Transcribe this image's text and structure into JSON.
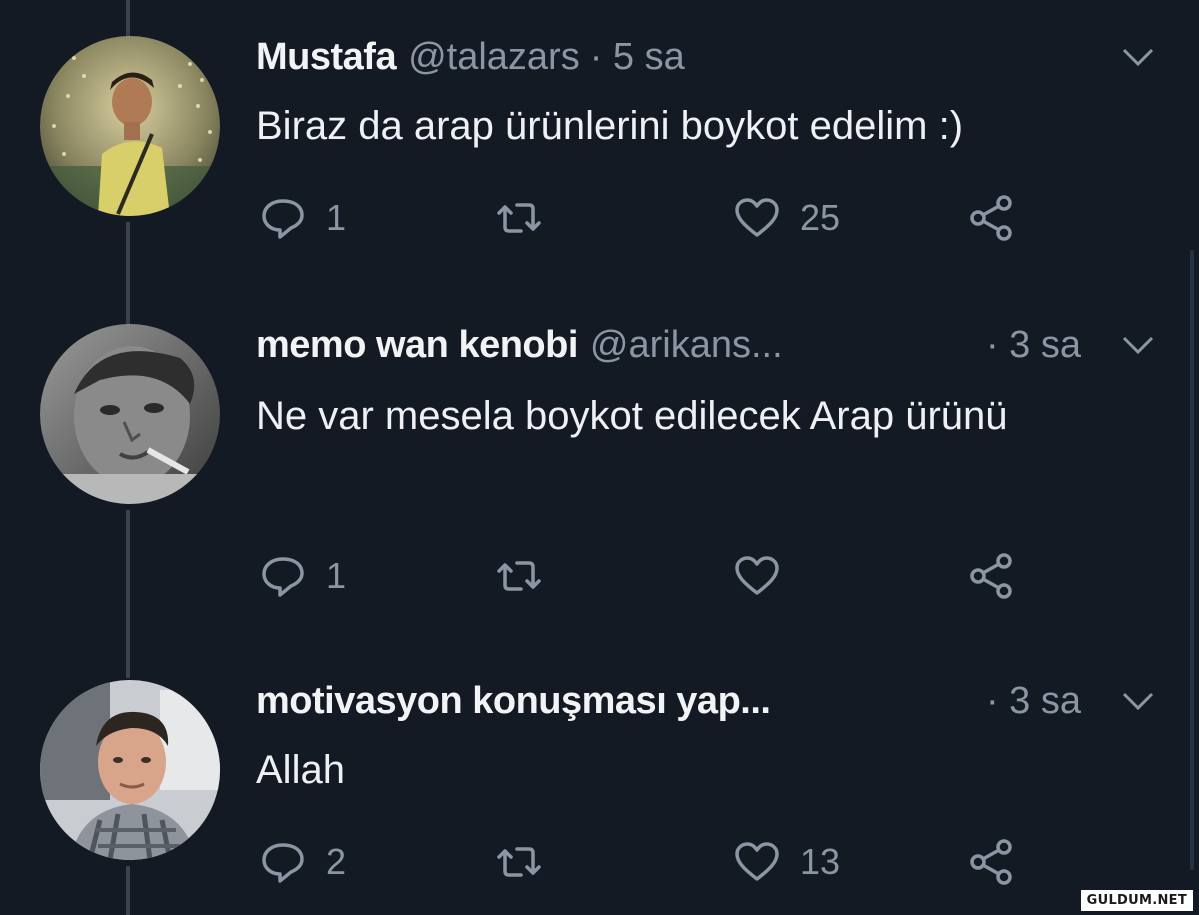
{
  "tweets": [
    {
      "name": "Mustafa",
      "handle": "@talazars",
      "time": "· 5 sa",
      "text": "Biraz da arap ürünlerini boykot edelim :)",
      "reply_count": "1",
      "retweet_count": "",
      "like_count": "25"
    },
    {
      "name": "memo wan kenobi",
      "handle": "@arikans...",
      "time": "· 3 sa",
      "text": "Ne var mesela boykot edilecek Arap ürünü",
      "reply_count": "1",
      "retweet_count": "",
      "like_count": ""
    },
    {
      "name": "motivasyon konuşması yap...",
      "handle": "",
      "time": "· 3 sa",
      "text": "Allah",
      "reply_count": "2",
      "retweet_count": "",
      "like_count": "13"
    }
  ],
  "icons": {
    "reply": "speech-bubble",
    "retweet": "retweet-arrows",
    "like": "heart",
    "share": "share-nodes",
    "menu": "chevron-down"
  },
  "colors": {
    "background": "#141a24",
    "muted": "#8b95a3",
    "text": "#eef0f3"
  },
  "watermark": "GULDUM.NET"
}
